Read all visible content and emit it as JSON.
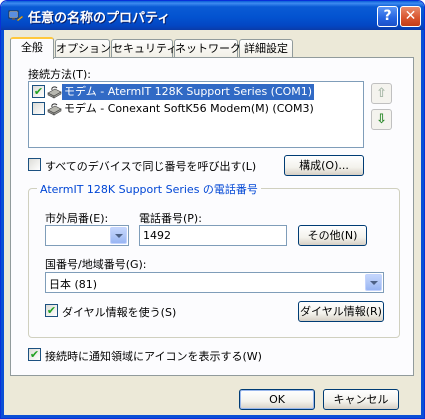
{
  "window": {
    "title": "任意の名称のプロパティ",
    "help_glyph": "?",
    "close_glyph": "✕"
  },
  "tabs": [
    {
      "label": "全般",
      "active": true
    },
    {
      "label": "オプション",
      "active": false
    },
    {
      "label": "セキュリティ",
      "active": false
    },
    {
      "label": "ネットワーク",
      "active": false
    },
    {
      "label": "詳細設定",
      "active": false
    }
  ],
  "connect_using": {
    "label": "接続方法(T):",
    "devices": [
      {
        "label": "モデム - AtermIT 128K Support Series (COM1)",
        "checked": true,
        "selected": true
      },
      {
        "label": "モデム - Conexant SoftK56 Modem(M) (COM3)",
        "checked": false,
        "selected": false
      }
    ],
    "up_glyph": "⇧",
    "down_glyph": "⇩"
  },
  "same_number": {
    "label": "すべてのデバイスで同じ番号を呼び出す(L)",
    "checked": false
  },
  "configure_button": "構成(O)...",
  "phone_group": {
    "title": "AtermIT 128K Support Series の電話番号",
    "area_code_label": "市外局番(E):",
    "area_code_value": "",
    "phone_label": "電話番号(P):",
    "phone_value": "1492",
    "alternates_button": "その他(N)",
    "country_label": "国番号/地域番号(G):",
    "country_value": "日本 (81)",
    "dialing_rules_label": "ダイヤル情報を使う(S)",
    "dialing_rules_checked": true,
    "dialing_rules_button": "ダイヤル情報(R)"
  },
  "show_icon": {
    "label": "接続時に通知領域にアイコンを表示する(W)",
    "checked": true
  },
  "footer": {
    "ok": "OK",
    "cancel": "キャンセル"
  },
  "colors": {
    "titlebar": "#0353d0",
    "selection": "#316ac5",
    "group_title": "#0046d5",
    "check": "#21a121"
  }
}
